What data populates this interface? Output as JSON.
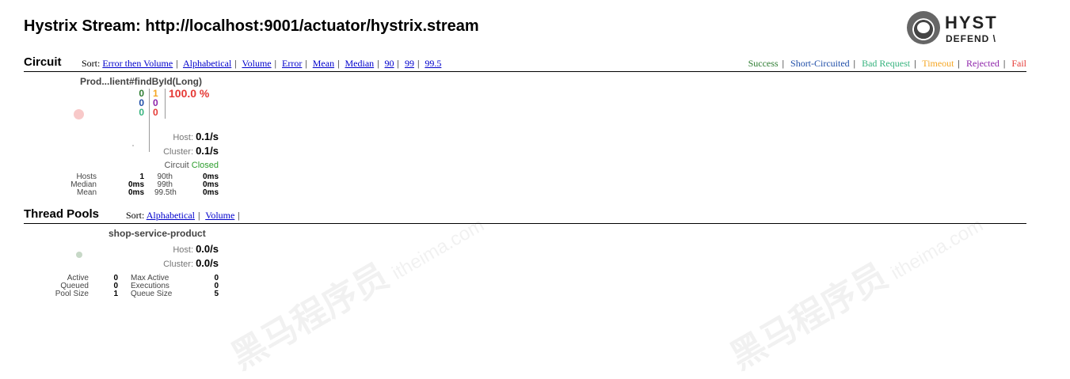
{
  "header": {
    "title": "Hystrix Stream: http://localhost:9001/actuator/hystrix.stream",
    "logo_line1": "HYST",
    "logo_line2": "DEFEND \\"
  },
  "circuit_section": {
    "title": "Circuit",
    "sort_label": "Sort:",
    "sort_links": [
      "Error then Volume",
      "Alphabetical",
      "Volume",
      "Error",
      "Mean",
      "Median",
      "90",
      "99",
      "99.5"
    ],
    "legend": [
      {
        "label": "Success",
        "color": "#2e7d32"
      },
      {
        "label": "Short-Circuited",
        "color": "#1f4ea8"
      },
      {
        "label": "Bad Request",
        "color": "#36b37e"
      },
      {
        "label": "Timeout",
        "color": "#f5a623"
      },
      {
        "label": "Rejected",
        "color": "#8e24aa"
      },
      {
        "label": "Fail",
        "color": "#e53935"
      }
    ]
  },
  "circuit": {
    "name": "Prod...lient#findById(Long)",
    "success": "0",
    "short_circuited": "0",
    "bad_request": "0",
    "timeout": "1",
    "rejected": "0",
    "failure": "0",
    "error_pct": "100.0 %",
    "host_label": "Host:",
    "host_rate": "0.1/s",
    "cluster_label": "Cluster:",
    "cluster_rate": "0.1/s",
    "status_label": "Circuit",
    "status_value": "Closed",
    "stats": {
      "hosts_label": "Hosts",
      "hosts": "1",
      "median_label": "Median",
      "median": "0ms",
      "mean_label": "Mean",
      "mean": "0ms",
      "p90_label": "90th",
      "p90": "0ms",
      "p99_label": "99th",
      "p99": "0ms",
      "p995_label": "99.5th",
      "p995": "0ms"
    },
    "colors": {
      "success": "#2e7d32",
      "short": "#1f4ea8",
      "bad": "#36b37e",
      "timeout": "#f5a623",
      "rejected": "#8e24aa",
      "fail": "#e53935",
      "pct": "#e53935",
      "closed": "#2e9e2e"
    }
  },
  "threadpool_section": {
    "title": "Thread Pools",
    "sort_label": "Sort:",
    "sort_links": [
      "Alphabetical",
      "Volume"
    ]
  },
  "threadpool": {
    "name": "shop-service-product",
    "host_label": "Host:",
    "host_rate": "0.0/s",
    "cluster_label": "Cluster:",
    "cluster_rate": "0.0/s",
    "stats": {
      "active_label": "Active",
      "active": "0",
      "queued_label": "Queued",
      "queued": "0",
      "pool_size_label": "Pool Size",
      "pool_size": "1",
      "max_active_label": "Max Active",
      "max_active": "0",
      "executions_label": "Executions",
      "executions": "0",
      "queue_size_label": "Queue Size",
      "queue_size": "5"
    }
  },
  "watermark": {
    "text": "黑马程序员",
    "suffix": "itheima.com"
  }
}
